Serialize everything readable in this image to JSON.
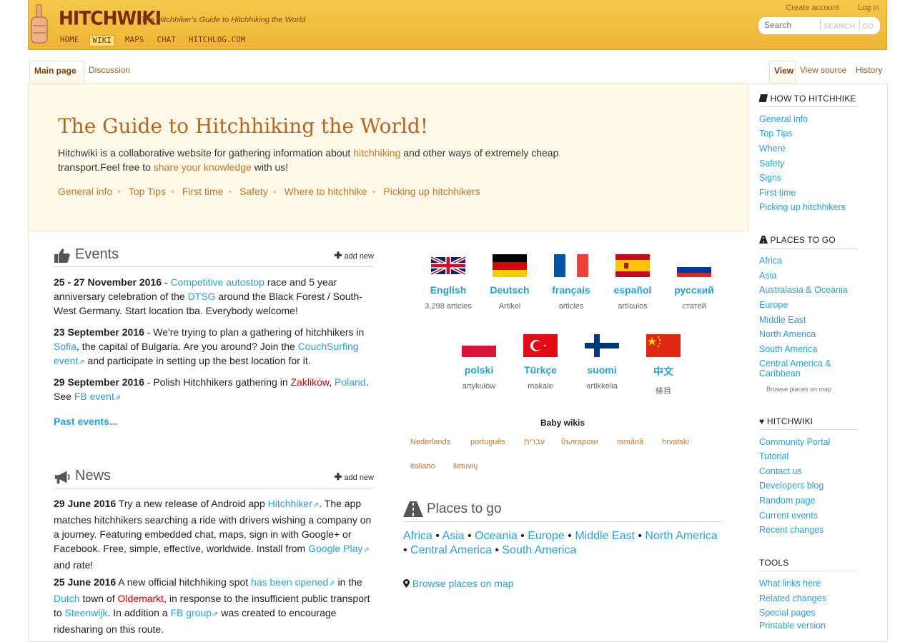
{
  "header": {
    "logo": "HITCHWIKI",
    "tagline": "The Hitchhiker's Guide to Hitchhiking the World",
    "nav": [
      "HOME",
      "WIKI",
      "MAPS",
      "CHAT",
      "HITCHLOG.COM"
    ],
    "create_account": "Create account",
    "login": "Log in",
    "search_placeholder": "Search",
    "search_btn": "SEARCH",
    "go_btn": "GO"
  },
  "tabs": {
    "main": "Main page",
    "discussion": "Discussion",
    "view": "View",
    "view_source": "View source",
    "history": "History"
  },
  "hero": {
    "title": "The Guide to Hitchhiking the World!",
    "text1": "Hitchwiki is a collaborative website for gathering information about ",
    "link1": "hitchhiking",
    "text2": " and other ways of extremely cheap transport.Feel free to ",
    "link2": "share your knowledge",
    "text3": " with us!",
    "quicklinks": [
      "General info",
      "Top Tips",
      "First time",
      "Safety",
      "Where to hitchhike",
      "Picking up hitchhikers"
    ]
  },
  "events": {
    "title": "Events",
    "add_new": "add new",
    "past": "Past events...",
    "e1_date": "25 - 27 November 2016",
    "e1_a": " - ",
    "e1_l1": "Competitive autostop",
    "e1_b": " race and 5 year anniversary celebration of the ",
    "e1_l2": "DTSG",
    "e1_c": " around the Black Forest / South-West Germany. Start location tba. Everybody welcome!",
    "e2_date": "23 September 2016",
    "e2_a": " - We're trying to plan a gathering of hitchhikers in ",
    "e2_l1": "Sofia",
    "e2_b": ", the capital of Bulgaria. Are you around? Join the ",
    "e2_l2": "CouchSurfing event",
    "e2_c": " and participate in setting up the best location for it.",
    "e3_date": "29 September 2016",
    "e3_a": " - Polish Hitchhikers gathering in ",
    "e3_l1": "Zaklików",
    "e3_b": ", ",
    "e3_l2": "Poland",
    "e3_c": ". See ",
    "e3_l3": "FB event"
  },
  "news": {
    "title": "News",
    "add_new": "add new",
    "n1_date": "29 June 2016",
    "n1_a": " Try a new release of Android app ",
    "n1_l1": "Hitchhiker",
    "n1_b": ". The app matches hitchhikers searching a ride with drivers wishing a company on a journey. Featuring embedded chat, maps, sign in with Google+ or Facebook. Free, simple, effective, worldwide. Install from ",
    "n1_l2": "Google Play",
    "n1_c": " and rate!",
    "n2_date": "25 June 2016",
    "n2_a": " A new official hitchhiking spot ",
    "n2_l1": "has been opened",
    "n2_b": " in the ",
    "n2_l2": "Dutch",
    "n2_c": " town of ",
    "n2_l3": "Oldemarkt",
    "n2_d": ", in response to the insufficient public transport to ",
    "n2_l4": "Steenwijk",
    "n2_e": ". In addition a ",
    "n2_l5": "FB group",
    "n2_f": " was created to encourage ridesharing on this route."
  },
  "languages": [
    {
      "name": "English",
      "count": "3,298 articles",
      "flag": "uk"
    },
    {
      "name": "Deutsch",
      "count": "Artikel",
      "flag": "de"
    },
    {
      "name": "français",
      "count": "articles",
      "flag": "fr"
    },
    {
      "name": "español",
      "count": "artículos",
      "flag": "es"
    },
    {
      "name": "русский",
      "count": "статей",
      "flag": "ru"
    },
    {
      "name": "polski",
      "count": "artykułów",
      "flag": "pl"
    },
    {
      "name": "Türkçe",
      "count": "makale",
      "flag": "tr"
    },
    {
      "name": "suomi",
      "count": "artikkelia",
      "flag": "fi"
    },
    {
      "name": "中文",
      "count": "條目",
      "flag": "cn"
    }
  ],
  "baby_title": "Baby wikis",
  "baby_wikis": [
    "Nederlands",
    "português",
    "עברית",
    "български",
    "română",
    "hrvatski",
    "italiano",
    "lietuvių"
  ],
  "places": {
    "title": "Places to go",
    "links": [
      "Africa",
      "Asia",
      "Oceania",
      "Europe",
      "Middle East",
      "North America",
      "Central America",
      "South America"
    ],
    "sep": " • ",
    "browse": "Browse places on map"
  },
  "sidebar": {
    "how_title": "HOW TO HITCHHIKE",
    "how": [
      "General info",
      "Top Tips",
      "Where",
      "Safety",
      "Signs",
      "First time",
      "Picking up hitchhikers"
    ],
    "places_title": "PLACES TO GO",
    "places": [
      "Africa",
      "Asia",
      "Australasia & Oceania",
      "Europe",
      "Middle East",
      "North America",
      "South America",
      "Central America & Caribbean"
    ],
    "browse": "Browse places on map",
    "hw_title": "HITCHWIKI",
    "hw": [
      "Community Portal",
      "Tutorial",
      "Contact us",
      "Developers blog",
      "Random page",
      "Current events",
      "Recent changes"
    ],
    "tools_title": "TOOLS",
    "tools": [
      "What links here",
      "Related changes",
      "Special pages",
      "Printable version"
    ]
  }
}
